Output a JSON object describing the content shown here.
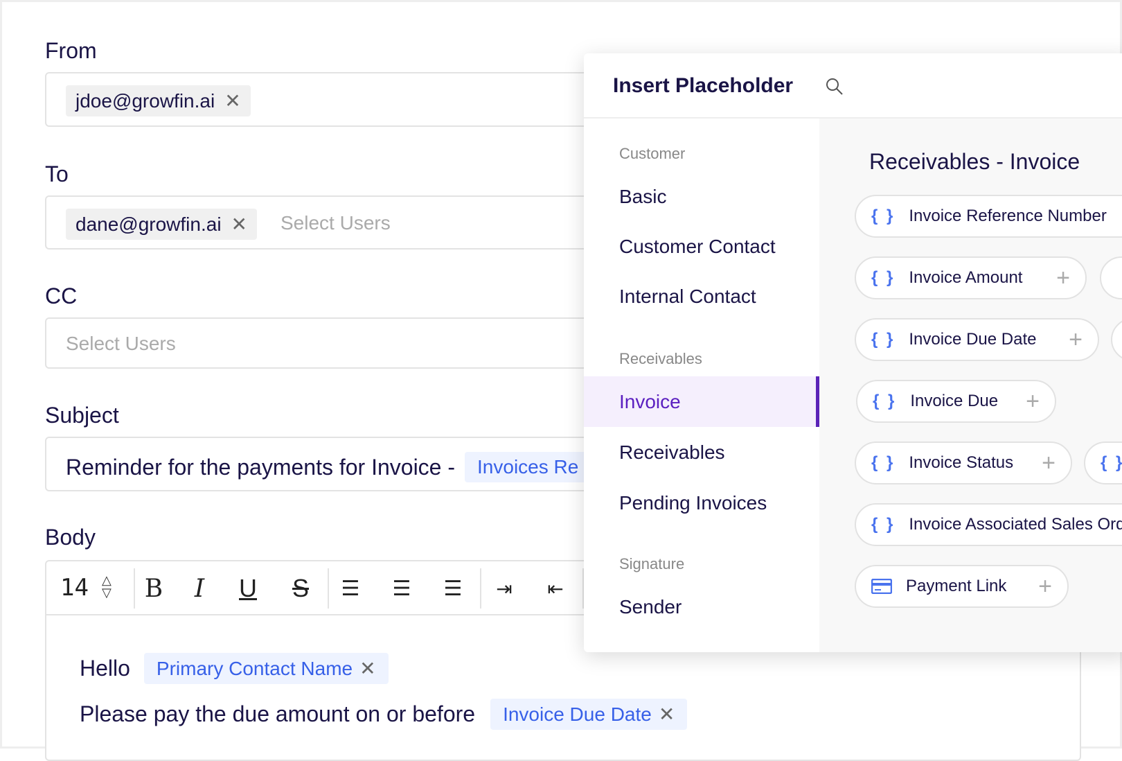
{
  "form": {
    "from_label": "From",
    "from_tag": "jdoe@growfin.ai",
    "to_label": "To",
    "to_tag": "dane@growfin.ai",
    "to_placeholder": "Select Users",
    "cc_label": "CC",
    "cc_placeholder": "Select Users",
    "subject_label": "Subject",
    "subject_text": "Reminder for the payments for Invoice -",
    "subject_chip": "Invoices Re",
    "body_label": "Body",
    "font_size": "14",
    "body_hello": "Hello",
    "body_chip1": "Primary Contact Name",
    "body_line2": "Please pay the due amount on or before",
    "body_chip2": "Invoice Due Date"
  },
  "toolbar": {
    "bold": "B",
    "italic": "I",
    "underline": "U",
    "strike": "S"
  },
  "panel": {
    "title": "Insert Placeholder",
    "nav": {
      "customer_header": "Customer",
      "basic": "Basic",
      "customer_contact": "Customer Contact",
      "internal_contact": "Internal Contact",
      "receivables_header": "Receivables",
      "invoice": "Invoice",
      "receivables": "Receivables",
      "pending_invoices": "Pending Invoices",
      "signature_header": "Signature",
      "sender": "Sender"
    },
    "section_title": "Receivables - Invoice",
    "chips": [
      "Invoice Reference Number",
      "Invoice Amount",
      "Invoice Due Date",
      "Invoice Due",
      "Invoice Status",
      "Invoice Associated Sales Order",
      "Payment Link"
    ],
    "brace": "{ }",
    "partial_brace": "{ }"
  },
  "colors": {
    "accent": "#5a22b8",
    "chip_blue": "#3760e8",
    "text": "#1a1446"
  }
}
